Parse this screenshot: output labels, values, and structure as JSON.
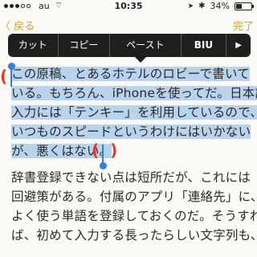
{
  "status_bar": {
    "carrier": "au",
    "time": "10:35",
    "battery": "34%"
  },
  "nav": {
    "back_label": "戻る",
    "done_label": "完了"
  },
  "edit_menu": {
    "cut": "カット",
    "copy": "コピー",
    "paste": "ペースト",
    "format": "BIU",
    "more": "▶"
  },
  "content": {
    "paragraph1": [
      "この原稿、とあるホテルのロビーで書いて",
      "いる。もちろん、iPhoneを使ってだ。日本語",
      "入力には「テンキー」を利用しているので、",
      "いつものスピードというわけにはいかない",
      "が、悪くはない。"
    ],
    "paragraph2": [
      "辞書登録できない点は短所だが、これには",
      "回避策がある。付属のアプリ「連絡先」に、",
      "よく使う単語を登録しておくのだ。そうすれ",
      "ば、初めて入力する長ったらしい文字列も、"
    ]
  },
  "colors": {
    "accent": "#d9a11d",
    "selection": "#b9d3ec",
    "handle": "#2f7ee0",
    "annotation": "#e43a2a"
  }
}
